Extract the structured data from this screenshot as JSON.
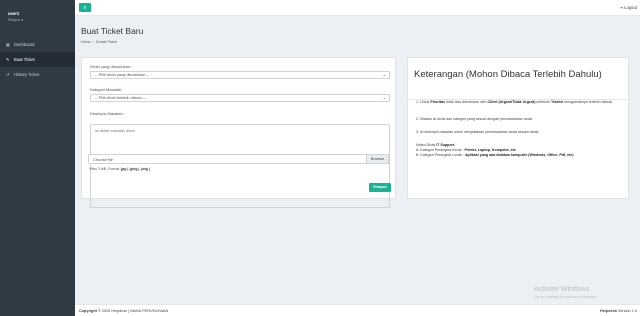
{
  "sidebar": {
    "user_name": "user1",
    "user_role": "Pelapor ▾",
    "items": [
      {
        "label": "Dashboard",
        "icon": "grid-icon"
      },
      {
        "label": "Buat Ticket",
        "icon": "edit-icon"
      },
      {
        "label": "History Ticket",
        "icon": "history-icon"
      }
    ]
  },
  "topbar": {
    "toggle_icon": "menu-icon",
    "logout_label": "Logout"
  },
  "header": {
    "title": "Buat Ticket Baru",
    "breadcrumb": [
      "Home",
      "Create Ticket"
    ]
  },
  "form": {
    "divisi_label": "Divisi yang dibutuhkan :",
    "divisi_value": "-- Pilih divisi yang dibutuhkan --",
    "kategori_label": "Kategori Masalah :",
    "kategori_value": "-- Pilih divisi terlebih dahulu --",
    "deskripsi_label": "Deskripsi Masalah :",
    "deskripsi_placeholder": "isi detail masalah disini",
    "file_text": "Choose file",
    "browse_label": "Browse",
    "note_prefix": "*Max 3 MB, Format",
    "note_formats": ".jpg | .jpeg | .png |",
    "save_label": "Simpan"
  },
  "info": {
    "title": "Keterangan (Mohon Dibaca Terlebih Dahulu)",
    "p1_a": "1. Untuk",
    "p1_b": "Prioritas",
    "p1_c": "tidak bisa ditentukan oleh",
    "p1_d": "Client (Urgent/Tidak Urgent)",
    "p1_e": "sebelum",
    "p1_f": "Teknisi",
    "p1_g": "mengamatinya terlebih dahulu.",
    "p2": "2. Silakan isi divisi dan kategori yang sesuai dengan permasalahan anda.",
    "p3": "3. isi deskripsi masalah untuk menjelaskan permasalahan anda secara detail.",
    "note_title_a": "Noted Divisi",
    "note_title_b": "IT Support",
    "note_title_c": ":",
    "note_a_prefix": "A. Kategori Perangkat Keras :",
    "note_a_items": "Printer, Laptop, Komputer, etc",
    "note_b_prefix": "B. Kategori Perangkat Lunak :",
    "note_b_items": "Aplikasi yang ada didalam komputer (Windows, Office, Pdf, etc)"
  },
  "watermark": {
    "line1": "Activate Windows",
    "line2": "Go to Settings to activate Windows."
  },
  "footer": {
    "copyright_bold": "Copyright",
    "copyright_rest": "© 2025 Helpdesk | NAMA PERUSAHAAN",
    "version_bold": "Helpdesk",
    "version_rest": "Version 1.0"
  }
}
